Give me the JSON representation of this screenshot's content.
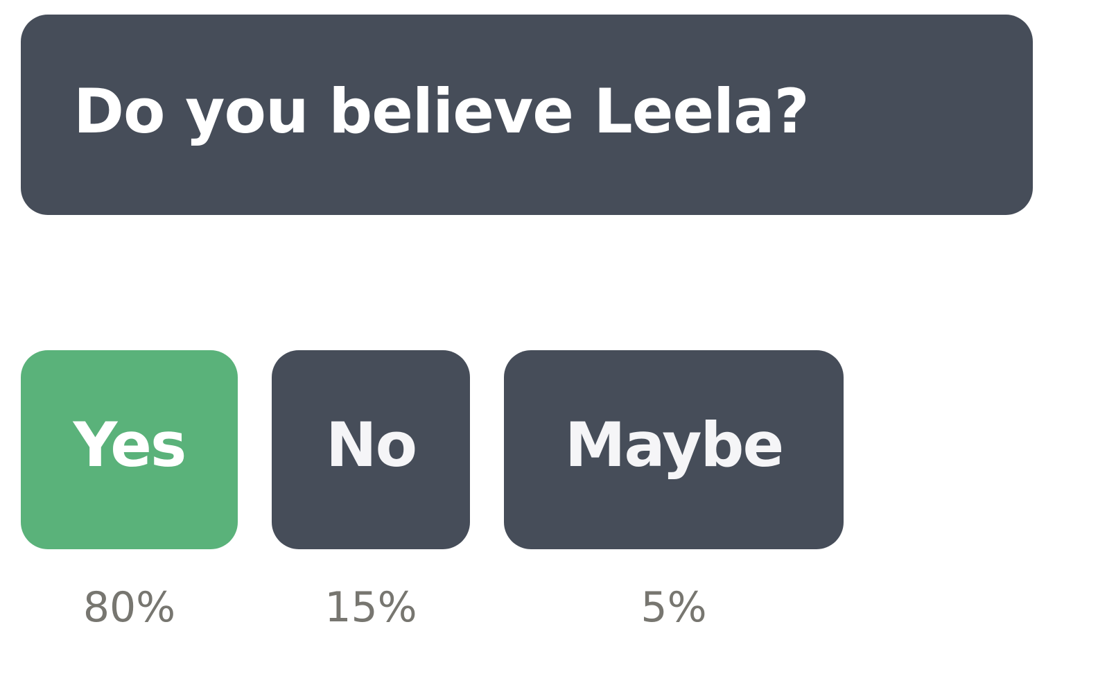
{
  "poll": {
    "question": "Do you believe Leela?",
    "options": [
      {
        "label": "Yes",
        "percent": "80%",
        "selected": true
      },
      {
        "label": "No",
        "percent": "15%",
        "selected": false
      },
      {
        "label": "Maybe",
        "percent": "5%",
        "selected": false
      }
    ]
  },
  "colors": {
    "panel": "#464d59",
    "selected": "#5ab27a",
    "percent_text": "#777670",
    "label_text": "#f5f5f7"
  }
}
